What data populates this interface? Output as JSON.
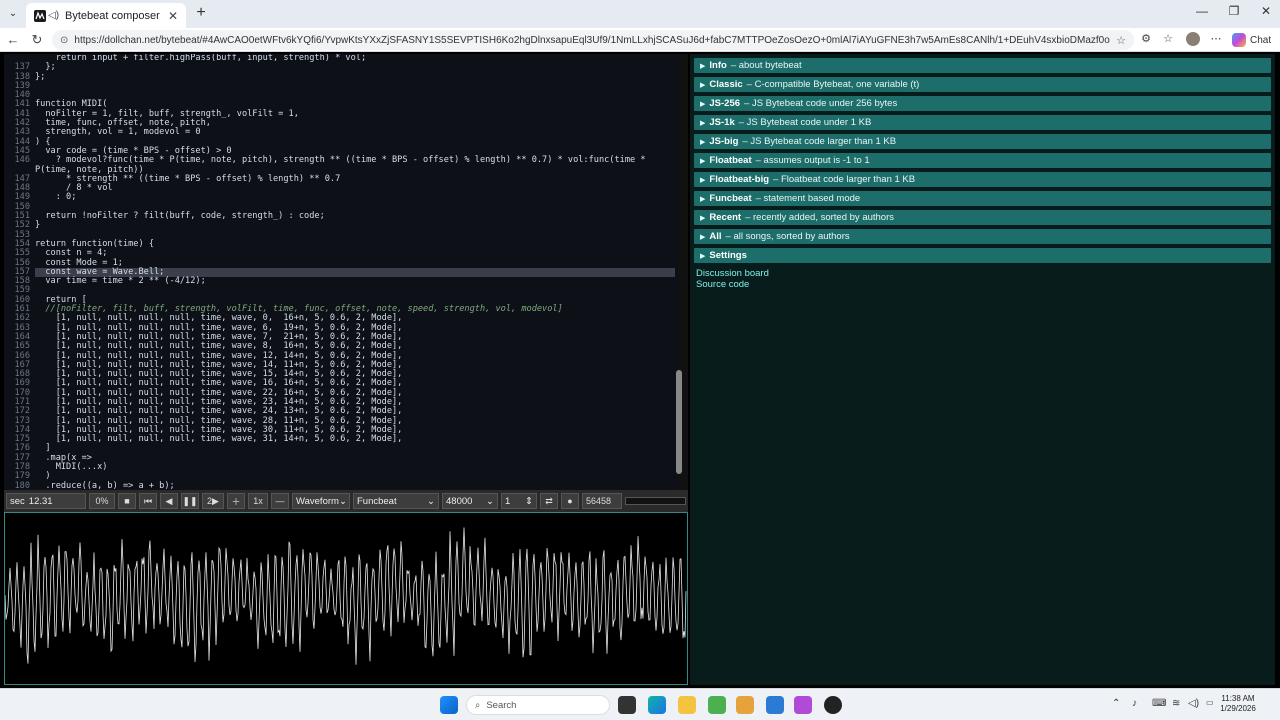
{
  "browser": {
    "tab_title": "Bytebeat composer",
    "url": "https://dollchan.net/bytebeat/#4AwCAO0etWFtv6kYQfi6/YvpwKtsYXxZjSFASNY1S5SEVPTISH6Ko2hgDlnxsapuEql3Uf9/1NmLLxhjSCASuJ6d+fabC7MTTPOeZosOezO+0mlAl7iAYuGFNE3h7w5AmEs8CANlh/1+DEuhV4sxbioDMazf0oQzmuKnKaeFKfbuLgR",
    "chat_label": "Chat"
  },
  "editor": {
    "lines": [
      {
        "n": "",
        "t": "    return input + filter.highPass(buff, input, strength) * vol;"
      },
      {
        "n": "137",
        "t": "  };"
      },
      {
        "n": "138",
        "t": "};"
      },
      {
        "n": "139",
        "t": ""
      },
      {
        "n": "140",
        "t": ""
      },
      {
        "n": "141",
        "t": "function MIDI("
      },
      {
        "n": "141",
        "t": "  noFilter = 1, filt, buff, strength_, volFilt = 1,"
      },
      {
        "n": "142",
        "t": "  time, func, offset, note, pitch,"
      },
      {
        "n": "143",
        "t": "  strength, vol = 1, modevol = 0"
      },
      {
        "n": "144",
        "t": ") {"
      },
      {
        "n": "145",
        "t": "  var code = (time * BPS - offset) > 0"
      },
      {
        "n": "146",
        "t": "    ? modevol?func(time * P(time, note, pitch), strength ** ((time * BPS - offset) % length) ** 0.7) * vol:func(time *"
      },
      {
        "n": "",
        "t": "P(time, note, pitch))"
      },
      {
        "n": "147",
        "t": "      * strength ** ((time * BPS - offset) % length) ** 0.7"
      },
      {
        "n": "148",
        "t": "      / 8 * vol"
      },
      {
        "n": "149",
        "t": "    : 0;"
      },
      {
        "n": "150",
        "t": ""
      },
      {
        "n": "151",
        "t": "  return !noFilter ? filt(buff, code, strength_) : code;"
      },
      {
        "n": "152",
        "t": "}"
      },
      {
        "n": "153",
        "t": ""
      },
      {
        "n": "154",
        "t": "return function(time) {"
      },
      {
        "n": "155",
        "t": "  const n = 4;"
      },
      {
        "n": "156",
        "t": "  const Mode = 1;"
      },
      {
        "n": "157",
        "t": "  const wave = Wave.Bell;"
      },
      {
        "n": "158",
        "t": "  var time = time * 2 ** (-4/12);"
      },
      {
        "n": "159",
        "t": ""
      },
      {
        "n": "160",
        "t": "  return ["
      },
      {
        "n": "161",
        "t": "  //[noFilter, filt, buff, strength, volFilt, time, func, offset, note, speed, strength, vol, modevol]"
      },
      {
        "n": "162",
        "t": "    [1, null, null, null, null, time, wave, 0,  16+n, 5, 0.6, 2, Mode],"
      },
      {
        "n": "163",
        "t": "    [1, null, null, null, null, time, wave, 6,  19+n, 5, 0.6, 2, Mode],"
      },
      {
        "n": "164",
        "t": "    [1, null, null, null, null, time, wave, 7,  21+n, 5, 0.6, 2, Mode],"
      },
      {
        "n": "165",
        "t": "    [1, null, null, null, null, time, wave, 8,  16+n, 5, 0.6, 2, Mode],"
      },
      {
        "n": "166",
        "t": "    [1, null, null, null, null, time, wave, 12, 14+n, 5, 0.6, 2, Mode],"
      },
      {
        "n": "167",
        "t": "    [1, null, null, null, null, time, wave, 14, 11+n, 5, 0.6, 2, Mode],"
      },
      {
        "n": "168",
        "t": "    [1, null, null, null, null, time, wave, 15, 14+n, 5, 0.6, 2, Mode],"
      },
      {
        "n": "169",
        "t": "    [1, null, null, null, null, time, wave, 16, 16+n, 5, 0.6, 2, Mode],"
      },
      {
        "n": "170",
        "t": "    [1, null, null, null, null, time, wave, 22, 16+n, 5, 0.6, 2, Mode],"
      },
      {
        "n": "171",
        "t": "    [1, null, null, null, null, time, wave, 23, 14+n, 5, 0.6, 2, Mode],"
      },
      {
        "n": "172",
        "t": "    [1, null, null, null, null, time, wave, 24, 13+n, 5, 0.6, 2, Mode],"
      },
      {
        "n": "173",
        "t": "    [1, null, null, null, null, time, wave, 28, 11+n, 5, 0.6, 2, Mode],"
      },
      {
        "n": "174",
        "t": "    [1, null, null, null, null, time, wave, 30, 11+n, 5, 0.6, 2, Mode],"
      },
      {
        "n": "175",
        "t": "    [1, null, null, null, null, time, wave, 31, 14+n, 5, 0.6, 2, Mode],"
      },
      {
        "n": "176",
        "t": "  ]"
      },
      {
        "n": "177",
        "t": "  .map(x =>"
      },
      {
        "n": "178",
        "t": "    MIDI(...x)"
      },
      {
        "n": "179",
        "t": "  )"
      },
      {
        "n": "180",
        "t": "  .reduce((a, b) => a + b);"
      },
      {
        "n": "181",
        "t": "};"
      }
    ]
  },
  "controls": {
    "time_unit": "sec",
    "time_value": "12.31",
    "percent": "0%",
    "rate_label": "1x",
    "speed_value": "2",
    "display_mode": "Waveform",
    "mode": "Funcbeat",
    "sample_rate": "48000",
    "scale": "1",
    "counter": "56458"
  },
  "library": {
    "sections": [
      {
        "name": "Info",
        "desc": "– about bytebeat"
      },
      {
        "name": "Classic",
        "desc": "– C-compatible Bytebeat, one variable (t)"
      },
      {
        "name": "JS-256",
        "desc": "– JS Bytebeat code under 256 bytes"
      },
      {
        "name": "JS-1k",
        "desc": "– JS Bytebeat code under 1 KB"
      },
      {
        "name": "JS-big",
        "desc": "– JS Bytebeat code larger than 1 KB"
      },
      {
        "name": "Floatbeat",
        "desc": "– assumes output is -1 to 1"
      },
      {
        "name": "Floatbeat-big",
        "desc": "– Floatbeat code larger than 1 KB"
      },
      {
        "name": "Funcbeat",
        "desc": "– statement based mode"
      },
      {
        "name": "Recent",
        "desc": "– recently added, sorted by authors"
      },
      {
        "name": "All",
        "desc": "– all songs, sorted by authors"
      },
      {
        "name": "Settings",
        "desc": ""
      }
    ],
    "links": [
      "Discussion board",
      "Source code"
    ]
  },
  "taskbar": {
    "search_placeholder": "Search",
    "time": "11:38 AM",
    "date": "1/29/2026"
  },
  "colors": {
    "accent": "#1d6e6b",
    "wave": "#e8e8e8",
    "editor_bg": "#0d1117"
  }
}
